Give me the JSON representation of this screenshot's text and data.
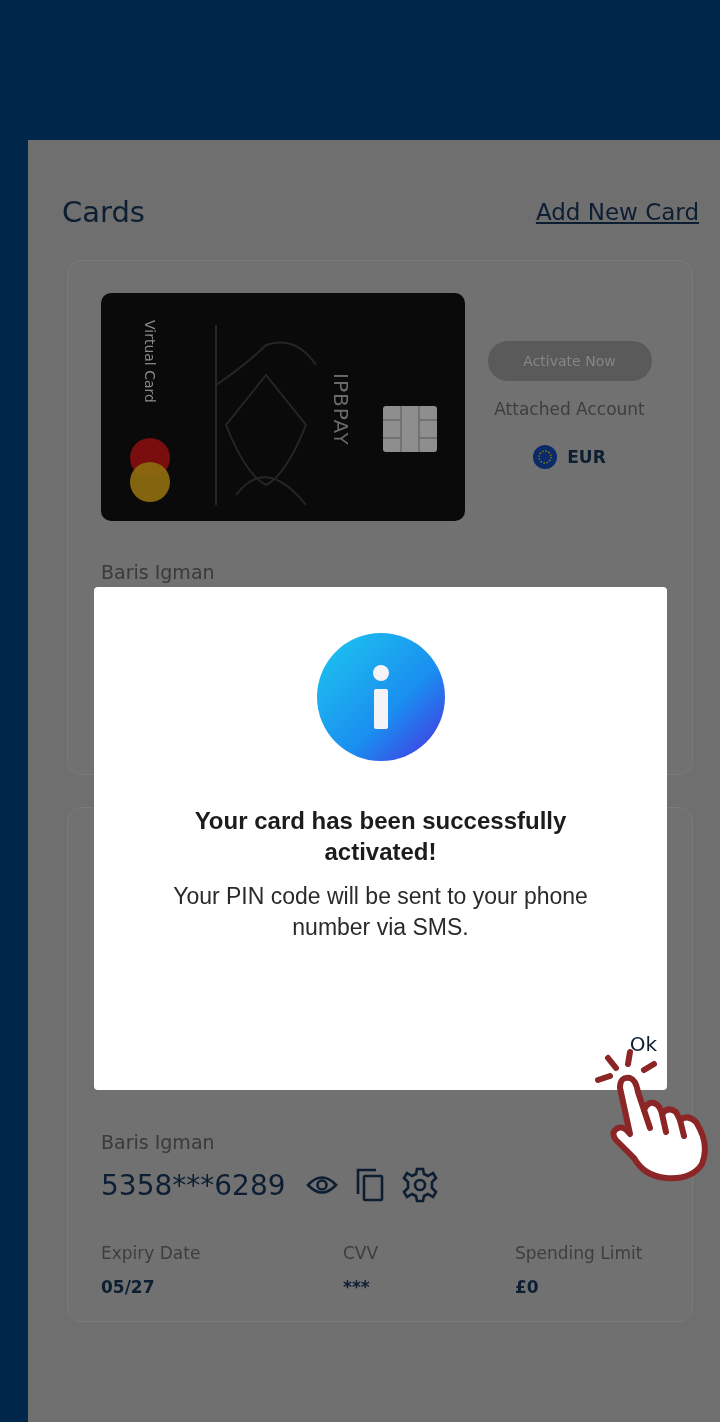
{
  "header": {
    "title": "Cards",
    "add_link": "Add New Card"
  },
  "cards": [
    {
      "kind": "preview",
      "card_label": "Virtual Card",
      "brand": "IPBPAY",
      "activate_button": "Activate Now",
      "attached_label": "Attached Account",
      "currency": "EUR",
      "holder": "Baris Igman"
    },
    {
      "kind": "details",
      "holder": "Baris Igman",
      "number": "5358***6289",
      "details": [
        {
          "label": "Expiry Date",
          "value": "05/27"
        },
        {
          "label": "CVV",
          "value": "***"
        },
        {
          "label": "Spending Limit",
          "value": "£0"
        }
      ]
    }
  ],
  "dialog": {
    "title": "Your card has been successfully activated!",
    "message": "Your PIN code will be sent to your phone number via SMS.",
    "ok_button": "Ok"
  }
}
